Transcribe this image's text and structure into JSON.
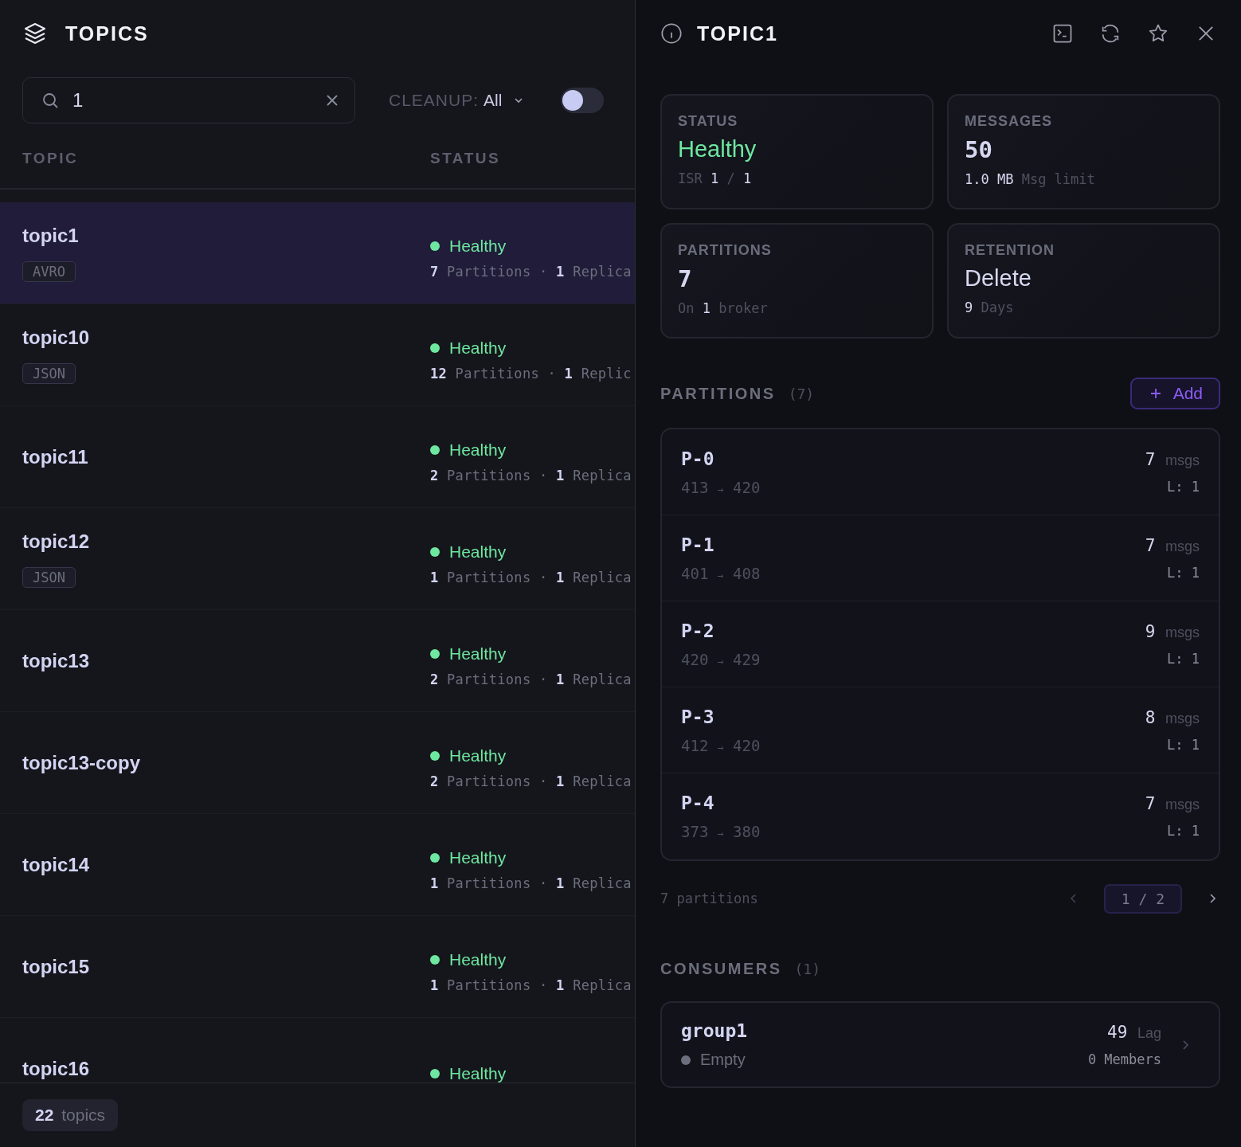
{
  "topics_panel": {
    "title": "TOPICS",
    "search": {
      "value": "1"
    },
    "filter": {
      "label": "CLEANUP:",
      "value": "All"
    },
    "toggle": {
      "on": false
    },
    "columns": [
      "TOPIC",
      "STATUS"
    ],
    "rows": [
      {
        "name": "topic1",
        "format": "AVRO",
        "selected": true,
        "status": "Healthy",
        "color": "#6ee7a0",
        "partitions": "7",
        "partitions_label": "Partitions",
        "separator": "·",
        "replicas": "1",
        "replicas_label": "Replica"
      },
      {
        "name": "topic10",
        "format": "JSON",
        "selected": false,
        "status": "Healthy",
        "color": "#6ee7a0",
        "partitions": "12",
        "partitions_label": "Partitions",
        "separator": "·",
        "replicas": "1",
        "replicas_label": "Replic"
      },
      {
        "name": "topic11",
        "selected": false,
        "status": "Healthy",
        "color": "#6ee7a0",
        "partitions": "2",
        "partitions_label": "Partitions",
        "separator": "·",
        "replicas": "1",
        "replicas_label": "Replica"
      },
      {
        "name": "topic12",
        "format": "JSON",
        "selected": false,
        "status": "Healthy",
        "color": "#6ee7a0",
        "partitions": "1",
        "partitions_label": "Partitions",
        "separator": "·",
        "replicas": "1",
        "replicas_label": "Replica"
      },
      {
        "name": "topic13",
        "selected": false,
        "status": "Healthy",
        "color": "#6ee7a0",
        "partitions": "2",
        "partitions_label": "Partitions",
        "separator": "·",
        "replicas": "1",
        "replicas_label": "Replica"
      },
      {
        "name": "topic13-copy",
        "selected": false,
        "status": "Healthy",
        "color": "#6ee7a0",
        "partitions": "2",
        "partitions_label": "Partitions",
        "separator": "·",
        "replicas": "1",
        "replicas_label": "Replica"
      },
      {
        "name": "topic14",
        "selected": false,
        "status": "Healthy",
        "color": "#6ee7a0",
        "partitions": "1",
        "partitions_label": "Partitions",
        "separator": "·",
        "replicas": "1",
        "replicas_label": "Replica"
      },
      {
        "name": "topic15",
        "selected": false,
        "status": "Healthy",
        "color": "#6ee7a0",
        "partitions": "1",
        "partitions_label": "Partitions",
        "separator": "·",
        "replicas": "1",
        "replicas_label": "Replica"
      },
      {
        "name": "topic16",
        "selected": false,
        "status": "Healthy",
        "color": "#6ee7a0"
      }
    ],
    "footer": {
      "count": "22",
      "label": "topics"
    }
  },
  "detail_panel": {
    "title": "TOPIC1",
    "stats": [
      {
        "label": "STATUS",
        "value": "Healthy",
        "kind": "status",
        "sub": [
          {
            "text": "ISR",
            "strong": false
          },
          {
            "text": "1",
            "strong": true
          },
          {
            "text": "/",
            "strong": false
          },
          {
            "text": "1",
            "strong": true
          }
        ]
      },
      {
        "label": "MESSAGES",
        "value": "50",
        "kind": "number",
        "sub": [
          {
            "text": "1.0 MB",
            "strong": true
          },
          {
            "text": "Msg limit",
            "strong": false
          }
        ]
      },
      {
        "label": "PARTITIONS",
        "value": "7",
        "kind": "number",
        "sub": [
          {
            "text": "On",
            "strong": false
          },
          {
            "text": "1",
            "strong": true
          },
          {
            "text": "broker",
            "strong": false
          }
        ]
      },
      {
        "label": "RETENTION",
        "value": "Delete",
        "kind": "text",
        "sub": [
          {
            "text": "9",
            "strong": true
          },
          {
            "text": "Days",
            "strong": false
          }
        ]
      }
    ],
    "partitions": {
      "title": "PARTITIONS",
      "count": "(7)",
      "add_button": "Add",
      "items": [
        {
          "name": "P-0",
          "from": "413",
          "arrow": "→",
          "to": "420",
          "msgs": "7",
          "msgs_label": "msgs",
          "leader": "L: 1"
        },
        {
          "name": "P-1",
          "from": "401",
          "arrow": "→",
          "to": "408",
          "msgs": "7",
          "msgs_label": "msgs",
          "leader": "L: 1"
        },
        {
          "name": "P-2",
          "from": "420",
          "arrow": "→",
          "to": "429",
          "msgs": "9",
          "msgs_label": "msgs",
          "leader": "L: 1"
        },
        {
          "name": "P-3",
          "from": "412",
          "arrow": "→",
          "to": "420",
          "msgs": "8",
          "msgs_label": "msgs",
          "leader": "L: 1"
        },
        {
          "name": "P-4",
          "from": "373",
          "arrow": "→",
          "to": "380",
          "msgs": "7",
          "msgs_label": "msgs",
          "leader": "L: 1"
        }
      ],
      "summary": "7 partitions",
      "page": "1 / 2"
    },
    "consumers": {
      "title": "CONSUMERS",
      "count": "(1)",
      "items": [
        {
          "name": "group1",
          "state": "Empty",
          "color": "#6b6e7c",
          "lag": "49",
          "lag_label": "Lag",
          "members": "0 Members"
        }
      ]
    }
  }
}
